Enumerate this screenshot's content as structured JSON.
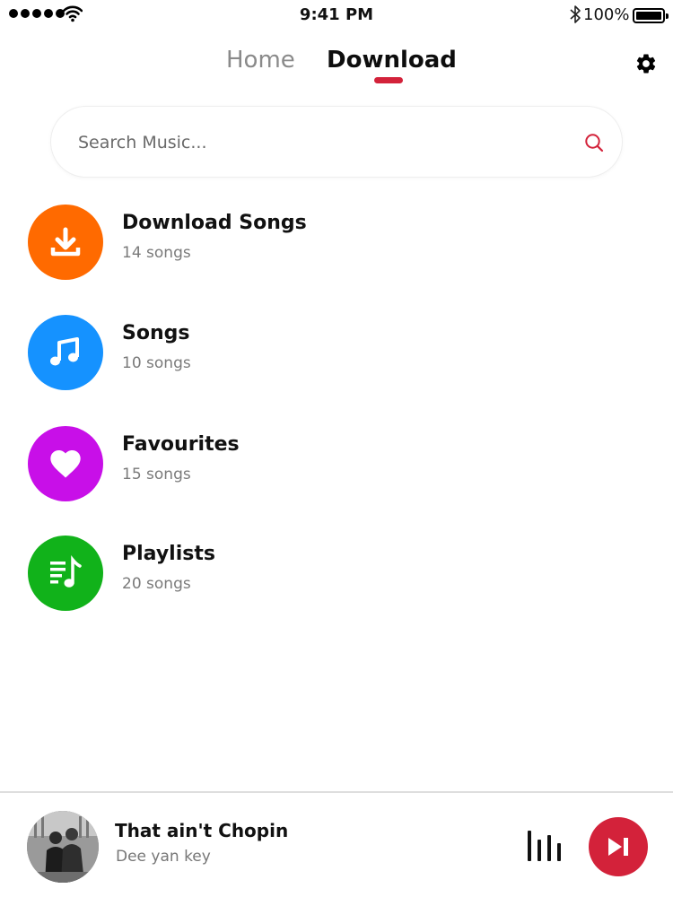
{
  "status_bar": {
    "time": "9:41 PM",
    "battery_text": "100%",
    "icons": [
      "signal-dots-icon",
      "wifi-icon",
      "bluetooth-icon",
      "battery-icon"
    ]
  },
  "tabs": [
    {
      "label": "Home",
      "active": false
    },
    {
      "label": "Download",
      "active": true
    }
  ],
  "settings_icon": "gear-icon",
  "search": {
    "placeholder": "Search Music...",
    "value": "",
    "icon": "search-icon"
  },
  "categories": [
    {
      "title": "Download Songs",
      "count": "14 songs",
      "icon": "download-icon",
      "color": "#ff6a00"
    },
    {
      "title": "Songs",
      "count": "10 songs",
      "icon": "music-note-icon",
      "color": "#1592ff"
    },
    {
      "title": "Favourites",
      "count": "15 songs",
      "icon": "heart-icon",
      "color": "#c80fe8"
    },
    {
      "title": "Playlists",
      "count": "20 songs",
      "icon": "playlist-icon",
      "color": "#11b21a"
    }
  ],
  "now_playing": {
    "title": "That ain't Chopin",
    "artist": "Dee yan key",
    "icons": [
      "album-art",
      "equalizer-icon",
      "skip-next-icon"
    ]
  },
  "colors": {
    "accent": "#d3223a",
    "text_primary": "#111111",
    "text_secondary": "#7a7a7a",
    "tab_inactive": "#8a8a8a"
  }
}
